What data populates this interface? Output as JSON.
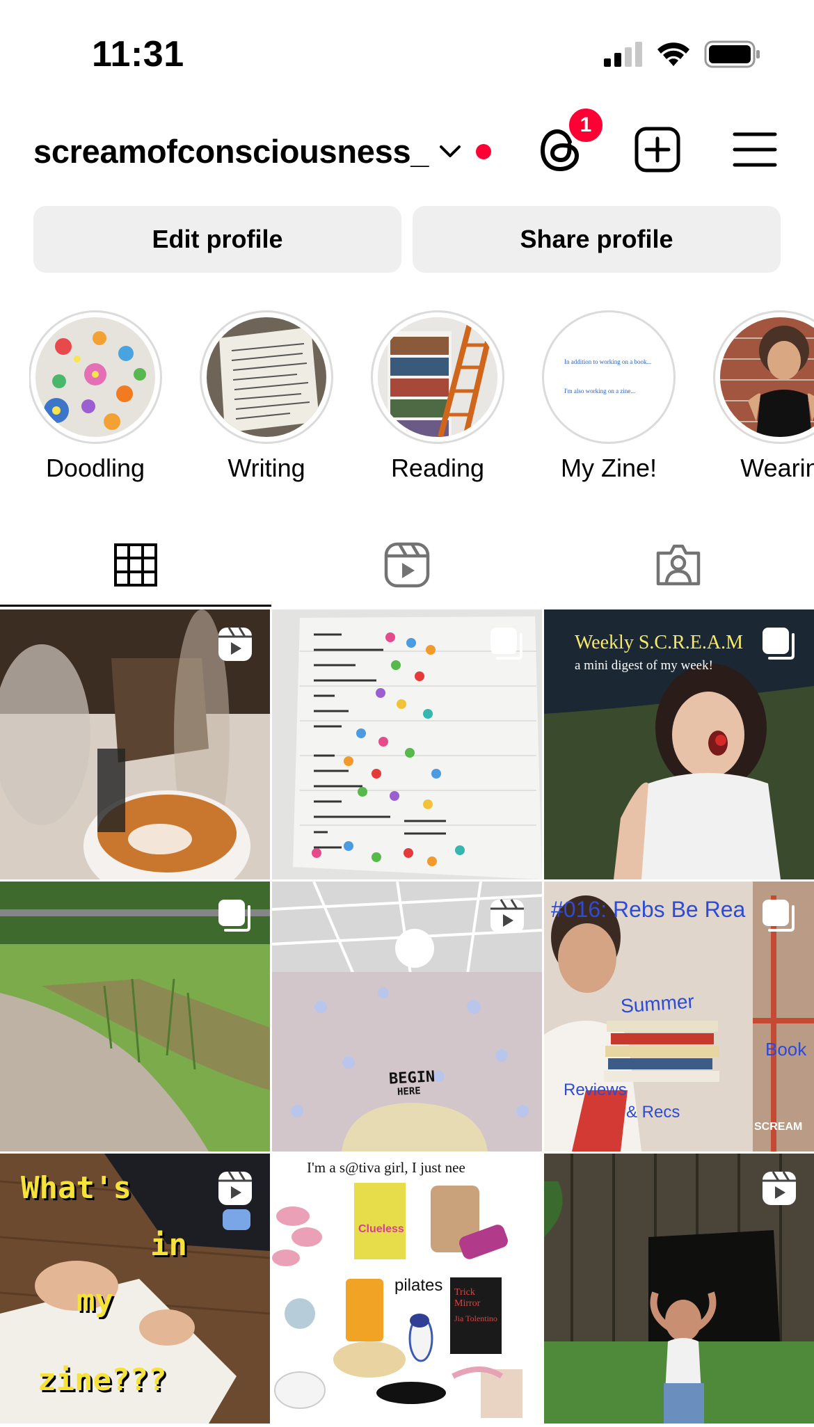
{
  "status_bar": {
    "time": "11:31"
  },
  "header": {
    "username": "screamofconsciousness_",
    "threads_badge": "1"
  },
  "profile_buttons": {
    "edit": "Edit profile",
    "share": "Share profile"
  },
  "highlights": [
    {
      "label": "Doodling"
    },
    {
      "label": "Writing"
    },
    {
      "label": "Reading"
    },
    {
      "label": "My Zine!",
      "thumb_text_1": "In addition to working on a book...",
      "thumb_text_2": "I'm also working on a zine..."
    },
    {
      "label": "Wearin"
    }
  ],
  "tabs": [
    "grid",
    "reels",
    "tagged"
  ],
  "grid": {
    "tile3": {
      "title": "Weekly S.C.R.E.A.M",
      "subtitle": "a mini digest of my week!"
    },
    "tile5": {
      "sign_1": "BEGIN",
      "sign_2": "HERE"
    },
    "tile6": {
      "title": "#016: Rebs Be Rea",
      "word_1": "Summer",
      "word_2": "Book",
      "word_3": "Reviews",
      "word_4": "& Recs",
      "watermark": "SCREAM"
    },
    "tile7": {
      "line_1": "What's",
      "line_2": "in",
      "line_3": "my",
      "line_4": "zine???"
    },
    "tile8": {
      "caption": "I'm a s@tiva girl, I just nee",
      "word_1": "Clueless",
      "word_2": "pilates",
      "word_3": "Trick Mirror",
      "word_4": "Jia Tolentino"
    }
  }
}
